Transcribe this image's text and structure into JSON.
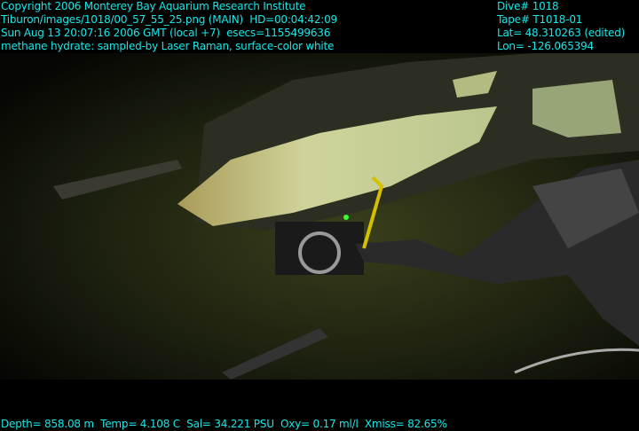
{
  "header_left": [
    "Copyright 2006 Monterey Bay Aquarium Research Institute",
    "Tiburon/images/1018/00_57_55_25.png (MAIN)  HD=00:04:42:09",
    "Sun Aug 13 20:07:16 2006 GMT (local +7)  esecs=1155499636",
    "methane hydrate: sampled-by Laser Raman, surface-color white"
  ],
  "header_right": [
    "Dive# 1018",
    "Tape# T1018-01",
    "Lat= 48.310263 (edited)",
    "Lon= -126.065394"
  ],
  "footer": "Depth= 858.08 m  Temp= 4.108 C  Sal= 34.221 PSU  Oxy= 0.17 ml/l  Xmiss= 82.65%",
  "colors": {
    "overlay_text": "#19e6e6",
    "background": "#000000"
  }
}
